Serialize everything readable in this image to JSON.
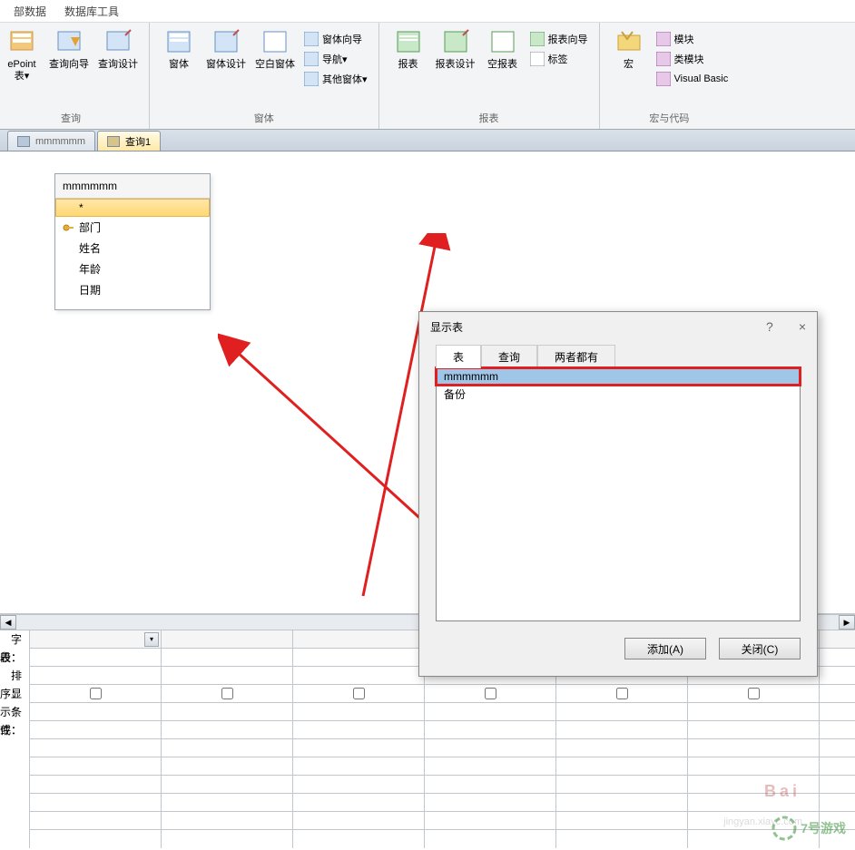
{
  "menubar": {
    "items": [
      "部数据",
      "数据库工具"
    ]
  },
  "ribbon": {
    "groups": [
      {
        "label": "查询",
        "big_buttons": [
          {
            "label": "ePoint\n表▾",
            "icon": "sharepoint-icon"
          },
          {
            "label": "查询向导",
            "icon": "query-wizard-icon"
          },
          {
            "label": "查询设计",
            "icon": "query-design-icon"
          }
        ]
      },
      {
        "label": "窗体",
        "big_buttons": [
          {
            "label": "窗体",
            "icon": "form-icon"
          },
          {
            "label": "窗体设计",
            "icon": "form-design-icon"
          },
          {
            "label": "空白窗体",
            "icon": "blank-form-icon"
          }
        ],
        "small_buttons": [
          {
            "label": "窗体向导",
            "icon": "form-wizard-icon"
          },
          {
            "label": "导航▾",
            "icon": "navigation-icon"
          },
          {
            "label": "其他窗体▾",
            "icon": "other-forms-icon"
          }
        ]
      },
      {
        "label": "报表",
        "big_buttons": [
          {
            "label": "报表",
            "icon": "report-icon"
          },
          {
            "label": "报表设计",
            "icon": "report-design-icon"
          },
          {
            "label": "空报表",
            "icon": "blank-report-icon"
          }
        ],
        "small_buttons": [
          {
            "label": "报表向导",
            "icon": "report-wizard-icon"
          },
          {
            "label": "标签",
            "icon": "label-icon"
          }
        ]
      },
      {
        "label": "宏与代码",
        "big_buttons": [
          {
            "label": "宏",
            "icon": "macro-icon"
          }
        ],
        "small_buttons": [
          {
            "label": "模块",
            "icon": "module-icon"
          },
          {
            "label": "类模块",
            "icon": "class-module-icon"
          },
          {
            "label": "Visual Basic",
            "icon": "visual-basic-icon"
          }
        ]
      }
    ]
  },
  "tabs": [
    {
      "label": "mmmmmm",
      "active": false
    },
    {
      "label": "查询1",
      "active": true
    }
  ],
  "table_box": {
    "title": "mmmmmm",
    "fields": [
      "*",
      "部门",
      "姓名",
      "年龄",
      "日期"
    ],
    "selected_index": 0,
    "key_field_index": 1
  },
  "query_grid": {
    "labels": [
      "字段：",
      "表：",
      "排序：",
      "显示：",
      "条件：",
      "或："
    ]
  },
  "dialog": {
    "title": "显示表",
    "help_label": "?",
    "close_label": "×",
    "tabs": [
      "表",
      "查询",
      "两者都有"
    ],
    "active_tab_index": 0,
    "items": [
      "mmmmmm",
      "备份"
    ],
    "selected_index": 0,
    "buttons": {
      "add": "添加(A)",
      "close": "关闭(C)"
    }
  },
  "watermark": {
    "text1": "7号游戏",
    "text2": "Bai",
    "sub": "jingyan.xiayc.com"
  }
}
